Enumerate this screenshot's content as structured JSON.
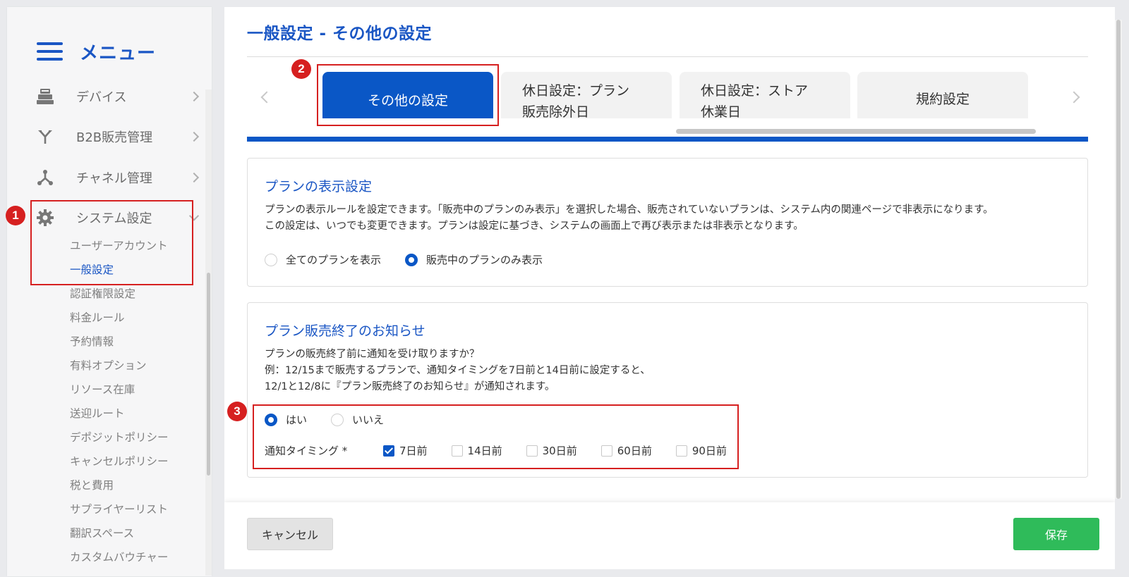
{
  "sidebar": {
    "menu_title": "メニュー",
    "items": [
      {
        "label": "デバイス",
        "icon": "cash-register-icon"
      },
      {
        "label": "B2B販売管理",
        "icon": "split-arrows-icon"
      },
      {
        "label": "チャネル管理",
        "icon": "network-icon"
      },
      {
        "label": "システム設定",
        "icon": "gear-icon"
      }
    ],
    "sub_items": [
      "ユーザーアカウント",
      "一般設定",
      "認証権限設定",
      "料金ルール",
      "予約情報",
      "有料オプション",
      "リソース在庫",
      "送迎ルート",
      "デポジットポリシー",
      "キャンセルポリシー",
      "税と費用",
      "サプライヤーリスト",
      "翻訳スペース",
      "カスタムバウチャー"
    ],
    "active_sub": "一般設定"
  },
  "page_title": "一般設定  - その他の設定",
  "tabs": {
    "partial": "）",
    "items": [
      {
        "line1": "その他の設定",
        "line2": "",
        "active": true
      },
      {
        "line1": "休日設定：プラン",
        "line2": "販売除外日",
        "active": false
      },
      {
        "line1": "休日設定：ストア",
        "line2": "休業日",
        "active": false
      },
      {
        "line1": "規約設定",
        "line2": "",
        "active": false
      }
    ]
  },
  "plan_display": {
    "title": "プランの表示設定",
    "desc1": "プランの表示ルールを設定できます。「販売中のプランのみ表示」を選択した場合、販売されていないプランは、システム内の関連ページで非表示になります。",
    "desc2": "この設定は、いつでも変更できます。プランは設定に基づき、システムの画面上で再び表示または非表示となります。",
    "options": [
      "全てのプランを表示",
      "販売中のプランのみ表示"
    ],
    "selected": "販売中のプランのみ表示"
  },
  "plan_end": {
    "title": "プラン販売終了のお知らせ",
    "desc1": "プランの販売終了前に通知を受け取りますか？",
    "desc2": "例：12/15まで販売するプランで、通知タイミングを7日前と14日前に設定すると、",
    "desc3": "12/1と12/8に『プラン販売終了のお知らせ』が通知されます。",
    "options": [
      "はい",
      "いいえ"
    ],
    "selected": "はい",
    "timing_label": "通知タイミング *",
    "timings": [
      {
        "label": "7日前",
        "checked": true
      },
      {
        "label": "14日前",
        "checked": false
      },
      {
        "label": "30日前",
        "checked": false
      },
      {
        "label": "60日前",
        "checked": false
      },
      {
        "label": "90日前",
        "checked": false
      }
    ]
  },
  "footer": {
    "cancel_label": "キャンセル",
    "save_label": "保存"
  },
  "annotations": {
    "badge1": "1",
    "badge2": "2",
    "badge3": "3"
  },
  "colors": {
    "accent": "#1a56c4",
    "tab_active": "#0a57c6",
    "save": "#2fbb5a",
    "highlight": "#d62020"
  }
}
